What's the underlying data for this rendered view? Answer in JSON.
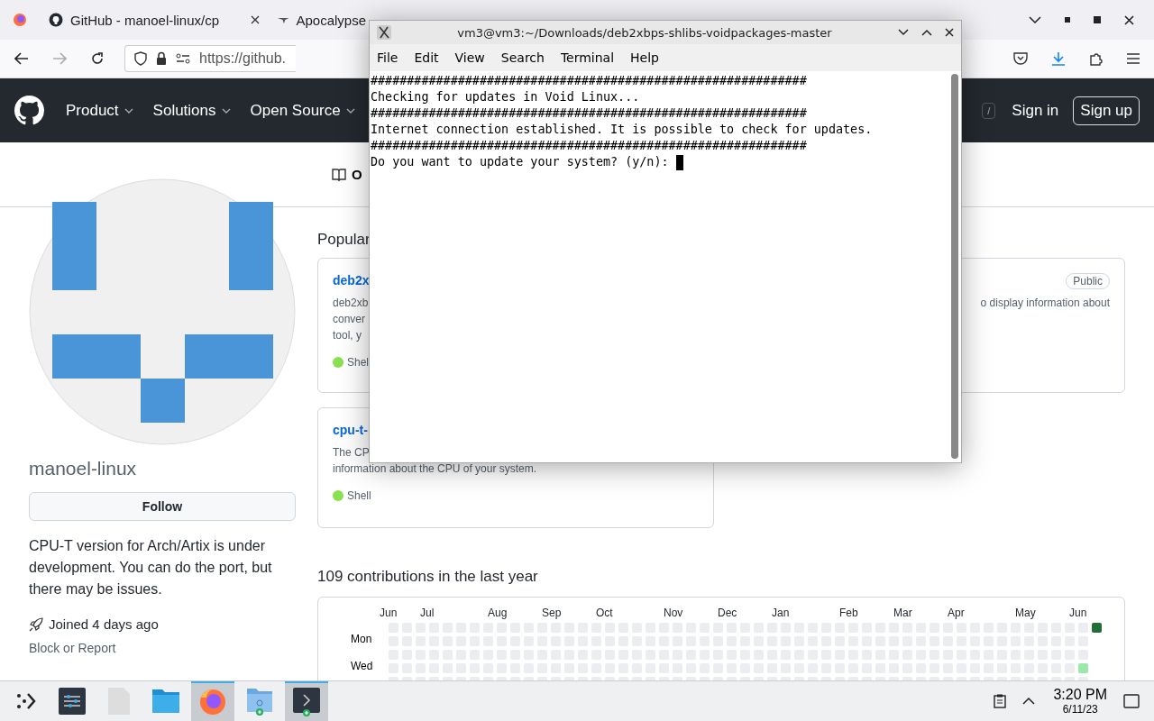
{
  "browser": {
    "tabs": [
      {
        "title": "GitHub - manoel-linux/cp",
        "selected": false
      },
      {
        "title": "Apocalypse",
        "selected": false
      }
    ],
    "url": "https://github."
  },
  "github": {
    "nav": [
      {
        "label": "Product"
      },
      {
        "label": "Solutions"
      },
      {
        "label": "Open Source"
      }
    ],
    "search_key": "/",
    "sign_in": "Sign in",
    "sign_up": "Sign up",
    "profile_tab": "O",
    "profile": {
      "name": "manoel-linux",
      "follow": "Follow",
      "bio": "CPU-T version for Arch/Artix is under development. You can do the port, but there may be issues.",
      "joined": "Joined 4 days ago",
      "block": "Block or Report"
    },
    "popular_heading": "Popular",
    "repos": [
      {
        "name": "deb2x",
        "lines": [
          "deb2xb",
          "conver",
          "tool, y"
        ],
        "language": "Shel"
      },
      {
        "badge": "Public",
        "lines": [
          "o display information about"
        ]
      },
      {
        "name": "cpu-t-",
        "lines": [
          "The CP",
          "information about the CPU of your system."
        ],
        "language": "Shell"
      }
    ],
    "contributions": {
      "title": "109 contributions in the last year",
      "months": [
        "Jun",
        "Jul",
        "Aug",
        "Sep",
        "Oct",
        "Nov",
        "Dec",
        "Jan",
        "Feb",
        "Mar",
        "Apr",
        "May",
        "Jun"
      ],
      "days": [
        "Mon",
        "Wed"
      ]
    }
  },
  "terminal": {
    "title": "vm3@vm3:~/Downloads/deb2xbps-shlibs-voidpackages-master",
    "menu": [
      "File",
      "Edit",
      "View",
      "Search",
      "Terminal",
      "Help"
    ],
    "lines": [
      "############################################################",
      "Checking for updates in Void Linux...",
      "############################################################",
      "Internet connection established. It is possible to check for updates.",
      "############################################################",
      "Do you want to update your system? (y/n): "
    ]
  },
  "taskbar": {
    "apps": [
      {
        "active": false
      },
      {
        "active": false
      },
      {
        "active": false
      },
      {
        "active": false
      },
      {
        "active": true
      },
      {
        "active": false
      },
      {
        "active": true
      }
    ],
    "time": "3:20 PM",
    "date": "6/11/23"
  }
}
